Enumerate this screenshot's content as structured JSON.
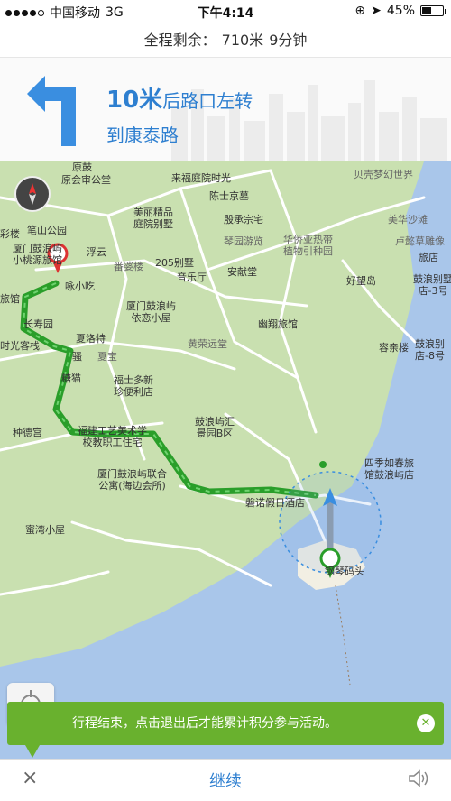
{
  "status_bar": {
    "carrier": "中国移动",
    "network": "3G",
    "time": "下午4:14",
    "battery": "45%",
    "battery_level": 0.45
  },
  "trip": {
    "remaining_label": "全程剩余：",
    "remaining_distance": "710米",
    "remaining_time": "9分钟"
  },
  "nav": {
    "distance": "10米",
    "action": "后路口左转",
    "road": "到康泰路"
  },
  "map": {
    "pois": [
      "原会审公堂",
      "来福庭院时光",
      "陈士京墓",
      "美丽精品",
      "庭院别墅",
      "殷承宗宅",
      "笔山公园",
      "厦门鼓浪屿",
      "小桃源旅馆",
      "浮云",
      "205别墅",
      "安献堂",
      "好望岛",
      "鼓浪别墅",
      "店-3号",
      "厦门鼓浪屿",
      "依恋小屋",
      "夏洛特",
      "咏小吃",
      "长寿园",
      "时光客栈",
      "幽翔旅馆",
      "鼓浪别",
      "店-8号",
      "福士多新",
      "珍便利店",
      "种德宫",
      "鼓浪屿汇",
      "景园B区",
      "福建工艺美术学",
      "校教职工住宅",
      "厦门鼓浪屿联合",
      "公寓(海边会所)",
      "磐诺假日酒店",
      "四季如春旅",
      "馆鼓浪屿店",
      "蜜湾小屋",
      "钢琴码头",
      "贝壳梦幻世界",
      "美华沙滩",
      "卢懿草雕像",
      "华侨亚热带",
      "植物引种园",
      "琴园游览",
      "番婆楼",
      "黄荣远堂",
      "夏宝",
      "旅馆",
      "彩楼",
      "骚",
      "音乐厅",
      "糖猫",
      "容亲楼",
      "旅店",
      "原鼓"
    ]
  },
  "toast": {
    "message": "行程结束，点击退出后才能累计积分参与活动。"
  },
  "bottom_bar": {
    "close_symbol": "×",
    "continue_label": "继续"
  }
}
